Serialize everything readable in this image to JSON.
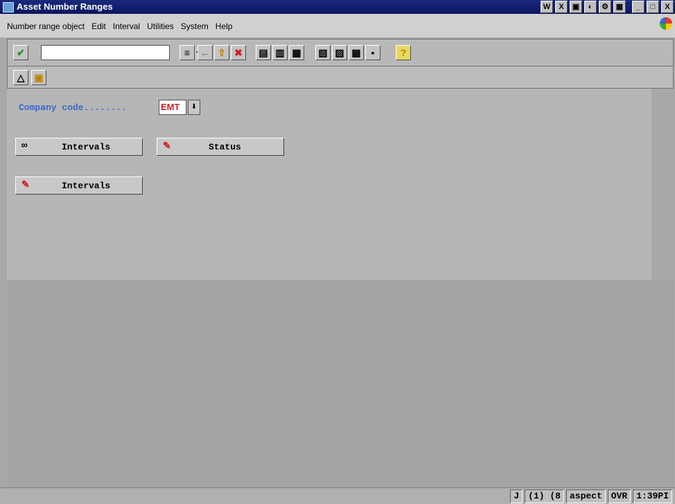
{
  "window": {
    "title": "Asset Number Ranges"
  },
  "title_icons": [
    "W",
    "X",
    "▣",
    "◐",
    "⚙",
    "▦"
  ],
  "window_controls": {
    "minimize": "_",
    "maximize": "□",
    "close": "X"
  },
  "menubar": {
    "items": [
      {
        "label": "Number range object"
      },
      {
        "label": "Edit"
      },
      {
        "label": "Interval"
      },
      {
        "label": "Utilities"
      },
      {
        "label": "System"
      },
      {
        "label": "Help"
      }
    ]
  },
  "toolbar": {
    "command_field_value": "",
    "buttons": [
      {
        "icon": "check-icon",
        "glyph": "✔"
      },
      {
        "icon": "save-icon",
        "glyph": "≡"
      },
      {
        "icon": "back-icon",
        "glyph": "←"
      },
      {
        "icon": "exit-icon",
        "glyph": "⇧"
      },
      {
        "icon": "cancel-icon",
        "glyph": "✖"
      },
      {
        "icon": "print-icon",
        "glyph": "▤"
      },
      {
        "icon": "find-icon",
        "glyph": "▥"
      },
      {
        "icon": "find-next-icon",
        "glyph": "▦"
      },
      {
        "icon": "first-page-icon",
        "glyph": "▧"
      },
      {
        "icon": "previous-page-icon",
        "glyph": "▨"
      },
      {
        "icon": "next-page-icon",
        "glyph": "▩"
      },
      {
        "icon": "last-page-icon",
        "glyph": "▪"
      },
      {
        "icon": "help-icon",
        "glyph": "?"
      }
    ]
  },
  "app_toolbar": {
    "buttons": [
      {
        "icon": "overview-icon",
        "glyph": "△"
      },
      {
        "icon": "copy-icon",
        "glyph": "▣"
      }
    ]
  },
  "form": {
    "company_code_label": "Company code........",
    "company_code_value": "EMT",
    "company_code_button": "⬇"
  },
  "buttons": {
    "intervals_display": {
      "label": "Intervals",
      "icon": "glasses-icon",
      "glyph": "∞"
    },
    "status": {
      "label": "Status",
      "icon": "pencil-icon",
      "glyph": "✎"
    },
    "intervals_change": {
      "label": "Intervals",
      "icon": "pencil-icon",
      "glyph": "✎"
    }
  },
  "statusbar": {
    "fields": [
      "J",
      "(1) (8",
      "aspect",
      "OVR",
      "1:39PI"
    ]
  }
}
